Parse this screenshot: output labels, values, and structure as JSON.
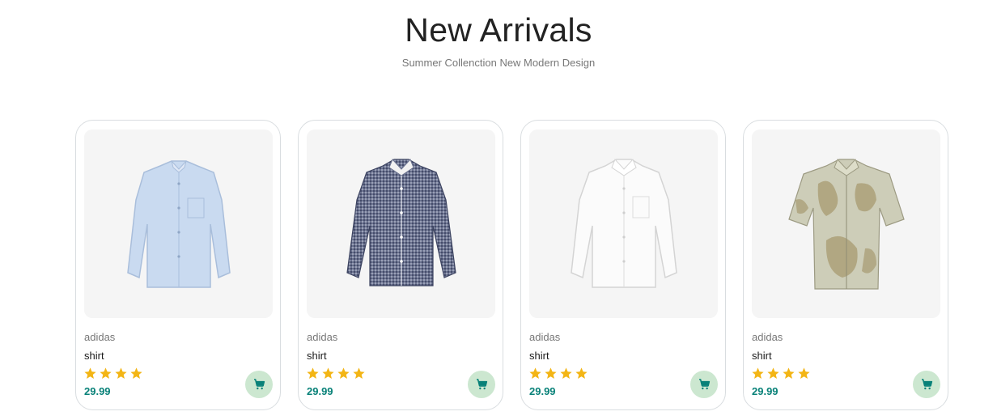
{
  "section": {
    "title": "New Arrivals",
    "subtitle": "Summer Collenction New Modern Design"
  },
  "colors": {
    "accent": "#088178",
    "cart_bg": "#cce7d0",
    "star": "#f3b515",
    "card_border": "#d9dde0",
    "image_bg": "#f5f5f5"
  },
  "products": [
    {
      "brand": "adidas",
      "name": "shirt",
      "rating": 4,
      "price": "29.99",
      "image": "light-blue-long-sleeve-shirt",
      "icon": "cart-icon"
    },
    {
      "brand": "adidas",
      "name": "shirt",
      "rating": 4,
      "price": "29.99",
      "image": "navy-gingham-long-sleeve-shirt",
      "icon": "cart-icon"
    },
    {
      "brand": "adidas",
      "name": "shirt",
      "rating": 4,
      "price": "29.99",
      "image": "white-long-sleeve-shirt",
      "icon": "cart-icon"
    },
    {
      "brand": "adidas",
      "name": "shirt",
      "rating": 4,
      "price": "29.99",
      "image": "beige-print-short-sleeve-shirt",
      "icon": "cart-icon"
    }
  ]
}
